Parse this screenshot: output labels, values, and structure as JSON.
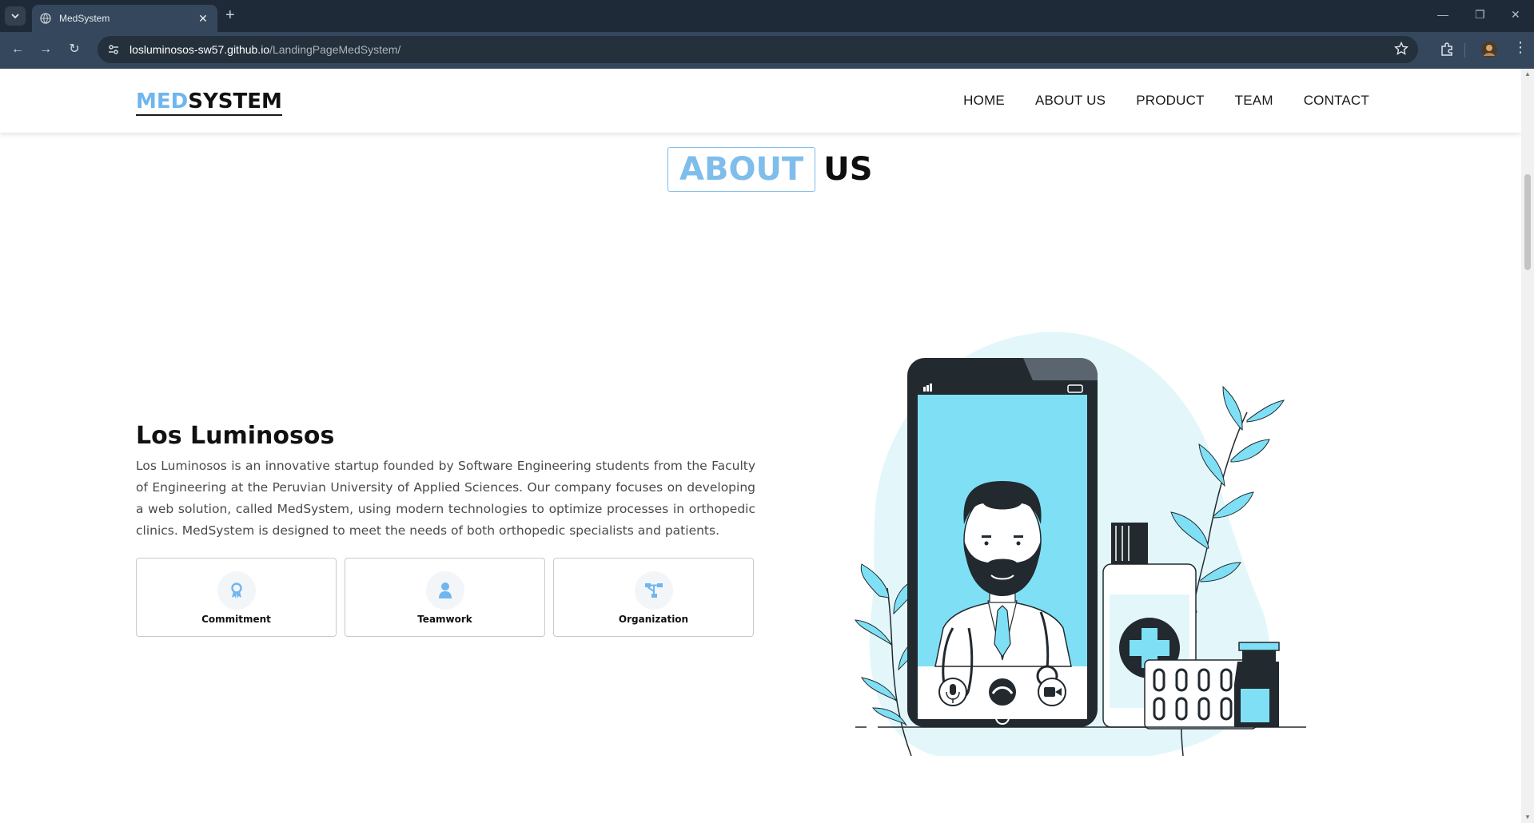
{
  "browser": {
    "tab_title": "MedSystem",
    "url_host": "losluminosos-sw57.github.io",
    "url_path": "/LandingPageMedSystem/"
  },
  "header": {
    "logo_part1": "MED",
    "logo_part2": "SYSTEM",
    "nav": [
      "HOME",
      "ABOUT US",
      "PRODUCT",
      "TEAM",
      "CONTACT"
    ]
  },
  "about": {
    "title_boxed": "ABOUT",
    "title_plain": "US",
    "company_name": "Los Luminosos",
    "description": "Los Luminosos is an innovative startup founded by Software Engineering students from the Faculty of Engineering at the Peruvian University of Applied Sciences. Our company focuses on developing a web solution, called MedSystem, using modern technologies to optimize processes in orthopedic clinics. MedSystem is designed to meet the needs of both orthopedic specialists and patients.",
    "values": [
      {
        "label": "Commitment",
        "icon": "ribbon-icon"
      },
      {
        "label": "Teamwork",
        "icon": "user-icon"
      },
      {
        "label": "Organization",
        "icon": "hierarchy-icon"
      }
    ]
  },
  "colors": {
    "accent": "#6fb6ef",
    "illustration_cyan": "#7fe0f5",
    "illustration_light": "#e3f7fb",
    "dark": "#22292f"
  }
}
